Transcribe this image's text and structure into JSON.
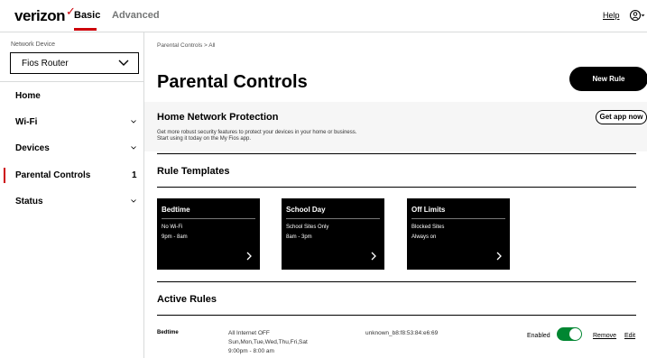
{
  "header": {
    "logo": "verizon",
    "tabs": [
      {
        "label": "Basic",
        "active": true
      },
      {
        "label": "Advanced",
        "active": false
      }
    ],
    "help_label": "Help",
    "user_icon": "user-icon"
  },
  "sidebar": {
    "device_label": "Network Device",
    "device_value": "Fios Router",
    "items": [
      {
        "label": "Home",
        "chevron": false
      },
      {
        "label": "Wi-Fi",
        "chevron": true
      },
      {
        "label": "Devices",
        "chevron": true
      },
      {
        "label": "Parental Controls",
        "count": "1",
        "active": true
      },
      {
        "label": "Status",
        "chevron": true
      }
    ]
  },
  "main": {
    "breadcrumb": "Parental Controls  >  All",
    "title": "Parental Controls",
    "new_rule_label": "New Rule",
    "protection": {
      "title": "Home Network Protection",
      "text_line1": "Get more robust security features to protect your devices in your home or business.",
      "text_line2": "Start using it today on the My Fios app.",
      "button_label": "Get app now"
    },
    "templates_title": "Rule Templates",
    "templates": [
      {
        "name": "Bedtime",
        "line1": "No Wi-Fi",
        "line2": "9pm - 8am"
      },
      {
        "name": "School Day",
        "line1": "School Sites Only",
        "line2": "8am - 3pm"
      },
      {
        "name": "Off Limits",
        "line1": "Blocked Sites",
        "line2": "Always on"
      }
    ],
    "active_title": "Active Rules",
    "rules": [
      {
        "name": "Bedtime",
        "detail1": "All Internet OFF",
        "detail2": "Sun,Mon,Tue,Wed,Thu,Fri,Sat",
        "detail3": "9:00pm - 8:00 am",
        "device": "unknown_b8:f8:53:84:e6:69",
        "status": "Enabled",
        "remove_label": "Remove",
        "edit_label": "Edit"
      }
    ]
  },
  "colors": {
    "accent_red": "#cd040b",
    "toggle_green": "#008631",
    "card_black": "#000000",
    "banner_gray": "#f6f6f6"
  }
}
